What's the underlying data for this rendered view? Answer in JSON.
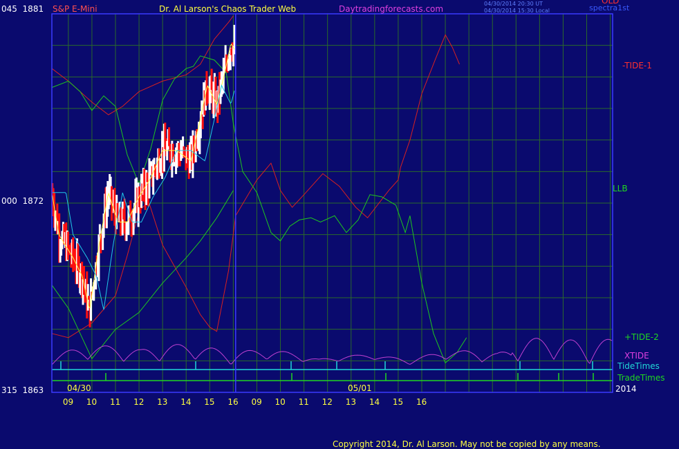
{
  "header": {
    "title_left": "S&P E-Mini",
    "title_center": "Dr. Al Larson's Chaos Trader Web",
    "site": "Daytradingforecasts.com",
    "time_ut": "04/30/2014 20:30 UT",
    "time_local": "04/30/2014 15:30 Local",
    "spectra_label": "spectra1st",
    "top_right_label": "OLD"
  },
  "y_axis_labels": [
    {
      "prefix": "045",
      "price": "1881"
    },
    {
      "prefix": "000",
      "price": "1872"
    },
    {
      "prefix": "315",
      "price": "1863"
    }
  ],
  "x_axis": {
    "date_left": "04/30",
    "date_mid": "05/01",
    "year": "2014",
    "ticks": [
      "09",
      "10",
      "11",
      "12",
      "13",
      "14",
      "15",
      "16",
      "09",
      "10",
      "11",
      "12",
      "13",
      "14",
      "15",
      "16"
    ]
  },
  "legend": {
    "tide1": "-TIDE-1",
    "llb": "LLB",
    "tide2": "+TIDE-2",
    "xtide": "XTIDE",
    "tidetimes": "TideTimes",
    "tradetimes": "TradeTimes"
  },
  "footer": {
    "copyright": "Copyright 2014, Dr. Al Larson. May not be copied by any means."
  },
  "colors": {
    "background": "#0a0a6e",
    "grid": "#2a6a2a",
    "frame": "#3a3aff",
    "tide1": "#d82020",
    "llb": "#1ec81e",
    "xtide": "#c040d0",
    "tidetimes": "#20d8d8",
    "tradetimes": "#20d820",
    "price_up": "#ffffff",
    "price_down": "#ff1010",
    "ma_yellow": "#ffff40",
    "ma_cyan": "#20c8e8"
  },
  "chart_data": {
    "type": "line",
    "title": "S&P E-Mini",
    "ylim": [
      1863,
      1881
    ],
    "y_ticks": [
      1863,
      1872,
      1881
    ],
    "x_tick_labels": [
      "09",
      "10",
      "11",
      "12",
      "13",
      "14",
      "15",
      "16",
      "09",
      "10",
      "11",
      "12",
      "13",
      "14",
      "15",
      "16"
    ],
    "x_range_hours": [
      8.3,
      32.1
    ],
    "series": [
      {
        "name": "-TIDE-1",
        "points": [
          [
            8.3,
            1878.4
          ],
          [
            9,
            1877.8
          ],
          [
            10,
            1876.8
          ],
          [
            10.7,
            1876.2
          ],
          [
            11.3,
            1876.6
          ],
          [
            12,
            1877.3
          ],
          [
            13,
            1877.8
          ],
          [
            14,
            1878.1
          ],
          [
            14.6,
            1878.6
          ],
          [
            15.2,
            1879.8
          ],
          [
            15.8,
            1880.6
          ],
          [
            16,
            1880.9
          ]
        ]
      },
      {
        "name": "-TIDE-1 lower",
        "points": [
          [
            8.3,
            1865.8
          ],
          [
            9,
            1865.6
          ],
          [
            10,
            1866.3
          ],
          [
            11,
            1867.6
          ],
          [
            11.5,
            1869.5
          ],
          [
            12,
            1871.6
          ],
          [
            12.4,
            1872.1
          ],
          [
            13,
            1870
          ],
          [
            14,
            1868
          ],
          [
            14.6,
            1866.7
          ],
          [
            15,
            1866.1
          ],
          [
            15.3,
            1865.9
          ],
          [
            15.8,
            1868.8
          ],
          [
            16.1,
            1871.4
          ],
          [
            17,
            1873.1
          ],
          [
            17.6,
            1873.9
          ],
          [
            18,
            1872.6
          ],
          [
            18.5,
            1871.8
          ],
          [
            19,
            1872.4
          ],
          [
            19.8,
            1873.4
          ],
          [
            20.5,
            1872.8
          ],
          [
            21.2,
            1871.8
          ],
          [
            21.7,
            1871.3
          ],
          [
            22.6,
            1872.6
          ],
          [
            23,
            1873.1
          ],
          [
            23.1,
            1873.7
          ],
          [
            23.5,
            1875
          ],
          [
            24,
            1877.2
          ],
          [
            24.6,
            1878.9
          ],
          [
            25,
            1880
          ],
          [
            25.3,
            1879.4
          ],
          [
            25.6,
            1878.6
          ]
        ]
      },
      {
        "name": "LLB",
        "points": [
          [
            8.3,
            1877.5
          ],
          [
            9,
            1877.8
          ],
          [
            9.5,
            1877.3
          ],
          [
            10,
            1876.4
          ],
          [
            10.5,
            1877.1
          ],
          [
            11,
            1876.6
          ],
          [
            11.5,
            1874.3
          ],
          [
            12,
            1872.9
          ],
          [
            12.5,
            1874.6
          ],
          [
            13,
            1876.9
          ],
          [
            13.5,
            1877.9
          ],
          [
            14,
            1878.4
          ],
          [
            14.3,
            1878.5
          ],
          [
            14.6,
            1879
          ],
          [
            15.2,
            1878.8
          ],
          [
            15.7,
            1878.2
          ],
          [
            16,
            1875.8
          ],
          [
            16.4,
            1873.5
          ],
          [
            17,
            1872.5
          ],
          [
            17.6,
            1870.6
          ],
          [
            18,
            1870.2
          ],
          [
            18.4,
            1870.9
          ],
          [
            18.8,
            1871.2
          ],
          [
            19.3,
            1871.3
          ],
          [
            19.7,
            1871.1
          ],
          [
            20.3,
            1871.4
          ],
          [
            20.8,
            1870.6
          ],
          [
            21.3,
            1871.2
          ],
          [
            21.8,
            1872.4
          ],
          [
            22.3,
            1872.3
          ],
          [
            22.9,
            1871.9
          ],
          [
            23.3,
            1870.6
          ],
          [
            23.5,
            1871.4
          ],
          [
            24,
            1868.2
          ],
          [
            24.5,
            1865.8
          ],
          [
            25,
            1864.4
          ],
          [
            25.5,
            1864.9
          ],
          [
            25.9,
            1865.6
          ]
        ]
      },
      {
        "name": "+TIDE-2",
        "points": [
          [
            8.3,
            1868.1
          ],
          [
            9,
            1867
          ],
          [
            10,
            1864.6
          ],
          [
            11,
            1866
          ],
          [
            12,
            1866.8
          ],
          [
            13,
            1868.2
          ],
          [
            14,
            1869.4
          ],
          [
            14.6,
            1870.2
          ],
          [
            15.3,
            1871.3
          ],
          [
            16,
            1872.6
          ]
        ]
      }
    ],
    "price_range_hours": [
      8.3,
      16.1
    ],
    "price_low": 1866.6,
    "price_high": 1880.7,
    "price_last": 1879.2,
    "annotations": [
      "-TIDE-1",
      "LLB",
      "+TIDE-2",
      "XTIDE",
      "TideTimes",
      "TradeTimes"
    ]
  }
}
